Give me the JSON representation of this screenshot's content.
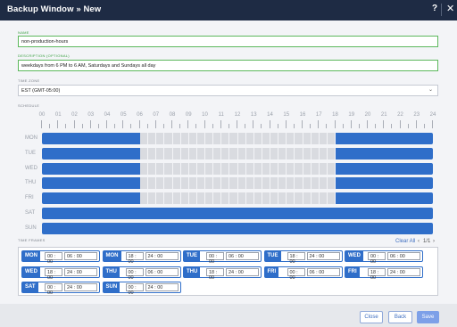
{
  "window": {
    "title": "Backup Window » New",
    "help_label": "?",
    "close_label": "✕"
  },
  "form": {
    "name": {
      "label": "NAME",
      "value": "non-production-hours"
    },
    "description": {
      "label": "DESCRIPTION (OPTIONAL)",
      "value": "weekdays from 6 PM to 6 AM, Saturdays and Sundays all day"
    },
    "timezone": {
      "label": "TIME ZONE",
      "value": "EST (GMT-05:00)"
    }
  },
  "schedule": {
    "label": "SCHEDULE",
    "hours": [
      "00",
      "01",
      "02",
      "03",
      "04",
      "05",
      "06",
      "07",
      "08",
      "09",
      "10",
      "11",
      "12",
      "13",
      "14",
      "15",
      "16",
      "17",
      "18",
      "19",
      "20",
      "21",
      "22",
      "23",
      "24"
    ],
    "days": [
      {
        "name": "MON",
        "active_ranges": [
          [
            0,
            6
          ],
          [
            18,
            24
          ]
        ]
      },
      {
        "name": "TUE",
        "active_ranges": [
          [
            0,
            6
          ],
          [
            18,
            24
          ]
        ]
      },
      {
        "name": "WED",
        "active_ranges": [
          [
            0,
            6
          ],
          [
            18,
            24
          ]
        ]
      },
      {
        "name": "THU",
        "active_ranges": [
          [
            0,
            6
          ],
          [
            18,
            24
          ]
        ]
      },
      {
        "name": "FRI",
        "active_ranges": [
          [
            0,
            6
          ],
          [
            18,
            24
          ]
        ]
      },
      {
        "name": "SAT",
        "active_ranges": [
          [
            0,
            24
          ]
        ]
      },
      {
        "name": "SUN",
        "active_ranges": [
          [
            0,
            24
          ]
        ]
      }
    ],
    "colors": {
      "active": "#2f6ec9",
      "inactive": "#d9dbe0"
    }
  },
  "time_frames": {
    "label": "TIME FRAMES",
    "clear_all": "Clear All",
    "prev": "‹",
    "page": "1/1",
    "next": "›",
    "items": [
      {
        "day": "MON",
        "start": "00 : 00",
        "end": "06 : 00"
      },
      {
        "day": "MON",
        "start": "18 : 00",
        "end": "24 : 00"
      },
      {
        "day": "TUE",
        "start": "00 : 00",
        "end": "06 : 00"
      },
      {
        "day": "TUE",
        "start": "18 : 00",
        "end": "24 : 00"
      },
      {
        "day": "WED",
        "start": "00 : 00",
        "end": "06 : 00"
      },
      {
        "day": "WED",
        "start": "18 : 00",
        "end": "24 : 00"
      },
      {
        "day": "THU",
        "start": "00 : 00",
        "end": "06 : 00"
      },
      {
        "day": "THU",
        "start": "18 : 00",
        "end": "24 : 00"
      },
      {
        "day": "FRI",
        "start": "00 : 00",
        "end": "06 : 00"
      },
      {
        "day": "FRI",
        "start": "18 : 00",
        "end": "24 : 00"
      },
      {
        "day": "SAT",
        "start": "00 : 00",
        "end": "24 : 00"
      },
      {
        "day": "SUN",
        "start": "00 : 00",
        "end": "24 : 00"
      }
    ]
  },
  "footer": {
    "close_label": "Close",
    "back_label": "Back",
    "save_label": "Save"
  }
}
